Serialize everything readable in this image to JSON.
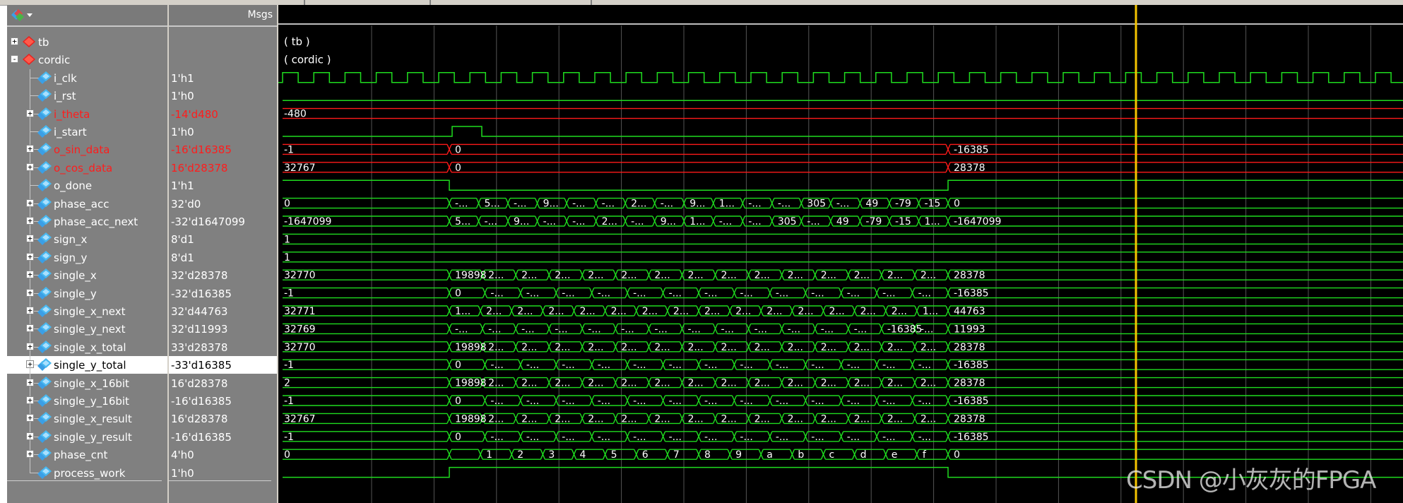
{
  "header": {
    "msgs_label": "Msgs"
  },
  "signals": [
    {
      "name": "tb",
      "value": "",
      "color": "white",
      "icon": "instance-icon",
      "expander": "+",
      "level": 0,
      "waveform": "label",
      "display": "( tb )"
    },
    {
      "name": "cordic",
      "value": "",
      "color": "white",
      "icon": "instance-icon",
      "expander": "-",
      "level": 0,
      "waveform": "label",
      "display": "( cordic )"
    },
    {
      "name": "i_clk",
      "value": "1'h1",
      "color": "white",
      "icon": "signal-icon",
      "expander": "",
      "level": 1,
      "waveform": "clock"
    },
    {
      "name": "i_rst",
      "value": "1'h0",
      "color": "white",
      "icon": "signal-icon",
      "expander": "",
      "level": 1,
      "waveform": "low"
    },
    {
      "name": "i_theta",
      "value": "-14'd480",
      "color": "red",
      "icon": "signal-icon",
      "expander": "+",
      "level": 1,
      "waveform": "bus",
      "wave_color": "red",
      "segments": [
        "-480"
      ]
    },
    {
      "name": "i_start",
      "value": "1'h0",
      "color": "white",
      "icon": "signal-icon",
      "expander": "",
      "level": 1,
      "waveform": "pulse"
    },
    {
      "name": "o_sin_data",
      "value": "-16'd16385",
      "color": "red",
      "icon": "signal-icon",
      "expander": "+",
      "level": 1,
      "waveform": "bus",
      "wave_color": "red",
      "segments": [
        "-1",
        "0",
        "-16385"
      ]
    },
    {
      "name": "o_cos_data",
      "value": "16'd28378",
      "color": "red",
      "icon": "signal-icon",
      "expander": "+",
      "level": 1,
      "waveform": "bus",
      "wave_color": "red",
      "segments": [
        "32767",
        "0",
        "28378"
      ]
    },
    {
      "name": "o_done",
      "value": "1'h1",
      "color": "white",
      "icon": "signal-icon",
      "expander": "",
      "level": 1,
      "waveform": "done"
    },
    {
      "name": "phase_acc",
      "value": "32'd0",
      "color": "white",
      "icon": "signal-icon",
      "expander": "+",
      "level": 1,
      "waveform": "bus",
      "wave_color": "green",
      "segments": [
        "0",
        "-...",
        "5...",
        "-...",
        "9...",
        "-...",
        "-...",
        "2...",
        "-...",
        "9...",
        "1...",
        "-...",
        "-...",
        "305",
        "-...",
        "49",
        "-79",
        "-15",
        "0"
      ]
    },
    {
      "name": "phase_acc_next",
      "value": "-32'd1647099",
      "color": "white",
      "icon": "signal-icon",
      "expander": "+",
      "level": 1,
      "waveform": "bus",
      "wave_color": "green",
      "segments": [
        "-1647099",
        "5...",
        "-...",
        "9...",
        "-...",
        "-...",
        "2...",
        "-...",
        "9...",
        "1...",
        "-...",
        "-...",
        "305",
        "-...",
        "49",
        "-79",
        "-15",
        "1...",
        "-1647099"
      ]
    },
    {
      "name": "sign_x",
      "value": "8'd1",
      "color": "white",
      "icon": "signal-icon",
      "expander": "+",
      "level": 1,
      "waveform": "bus",
      "wave_color": "green",
      "segments": [
        "1"
      ]
    },
    {
      "name": "sign_y",
      "value": "8'd1",
      "color": "white",
      "icon": "signal-icon",
      "expander": "+",
      "level": 1,
      "waveform": "bus",
      "wave_color": "green",
      "segments": [
        "1"
      ]
    },
    {
      "name": "single_x",
      "value": "32'd28378",
      "color": "white",
      "icon": "signal-icon",
      "expander": "+",
      "level": 1,
      "waveform": "bus",
      "wave_color": "green",
      "segments": [
        "32770",
        "19898",
        "2...",
        "2...",
        "2...",
        "2...",
        "2...",
        "2...",
        "2...",
        "2...",
        "2...",
        "2...",
        "2...",
        "2...",
        "2...",
        "2...",
        "28378"
      ]
    },
    {
      "name": "single_y",
      "value": "-32'd16385",
      "color": "white",
      "icon": "signal-icon",
      "expander": "+",
      "level": 1,
      "waveform": "bus",
      "wave_color": "green",
      "segments": [
        "-1",
        "0",
        "-...",
        "-...",
        "-...",
        "-...",
        "-...",
        "-...",
        "-...",
        "-...",
        "-...",
        "-...",
        "-...",
        "-...",
        "-...",
        "-16385"
      ]
    },
    {
      "name": "single_x_next",
      "value": "32'd44763",
      "color": "white",
      "icon": "signal-icon",
      "expander": "+",
      "level": 1,
      "waveform": "bus",
      "wave_color": "green",
      "segments": [
        "32771",
        "1...",
        "2...",
        "2...",
        "2...",
        "2...",
        "2...",
        "2...",
        "2...",
        "2...",
        "2...",
        "2...",
        "2...",
        "2...",
        "2...",
        "2...",
        "1...",
        "44763"
      ]
    },
    {
      "name": "single_y_next",
      "value": "32'd11993",
      "color": "white",
      "icon": "signal-icon",
      "expander": "+",
      "level": 1,
      "waveform": "bus",
      "wave_color": "green",
      "segments": [
        "32769",
        "-...",
        "-...",
        "-...",
        "-...",
        "-...",
        "-...",
        "-...",
        "-...",
        "-...",
        "-...",
        "-...",
        "-...",
        "-...",
        "-16385",
        "-...",
        "11993"
      ]
    },
    {
      "name": "single_x_total",
      "value": "33'd28378",
      "color": "white",
      "icon": "signal-icon",
      "expander": "+",
      "level": 1,
      "waveform": "bus",
      "wave_color": "green",
      "segments": [
        "32770",
        "19898",
        "2...",
        "2...",
        "2...",
        "2...",
        "2...",
        "2...",
        "2...",
        "2...",
        "2...",
        "2...",
        "2...",
        "2...",
        "2...",
        "2...",
        "28378"
      ]
    },
    {
      "name": "single_y_total",
      "value": "-33'd16385",
      "color": "white",
      "icon": "signal-icon",
      "expander": "+",
      "level": 1,
      "selected": true,
      "waveform": "bus",
      "wave_color": "green",
      "segments": [
        "-1",
        "0",
        "-...",
        "-...",
        "-...",
        "-...",
        "-...",
        "-...",
        "-...",
        "-...",
        "-...",
        "-...",
        "-...",
        "-...",
        "-...",
        "-16385"
      ]
    },
    {
      "name": "single_x_16bit",
      "value": "16'd28378",
      "color": "white",
      "icon": "signal-icon",
      "expander": "+",
      "level": 1,
      "waveform": "bus",
      "wave_color": "green",
      "segments": [
        "2",
        "19898",
        "2...",
        "2...",
        "2...",
        "2...",
        "2...",
        "2...",
        "2...",
        "2...",
        "2...",
        "2...",
        "2...",
        "2...",
        "2...",
        "2...",
        "28378"
      ]
    },
    {
      "name": "single_y_16bit",
      "value": "-16'd16385",
      "color": "white",
      "icon": "signal-icon",
      "expander": "+",
      "level": 1,
      "waveform": "bus",
      "wave_color": "green",
      "segments": [
        "-1",
        "0",
        "-...",
        "-...",
        "-...",
        "-...",
        "-...",
        "-...",
        "-...",
        "-...",
        "-...",
        "-...",
        "-...",
        "-...",
        "-...",
        "-16385"
      ]
    },
    {
      "name": "single_x_result",
      "value": "16'd28378",
      "color": "white",
      "icon": "signal-icon",
      "expander": "+",
      "level": 1,
      "waveform": "bus",
      "wave_color": "green",
      "segments": [
        "32767",
        "19898",
        "2...",
        "2...",
        "2...",
        "2...",
        "2...",
        "2...",
        "2...",
        "2...",
        "2...",
        "2...",
        "2...",
        "2...",
        "2...",
        "2...",
        "28378"
      ]
    },
    {
      "name": "single_y_result",
      "value": "-16'd16385",
      "color": "white",
      "icon": "signal-icon",
      "expander": "+",
      "level": 1,
      "waveform": "bus",
      "wave_color": "green",
      "segments": [
        "-1",
        "0",
        "-...",
        "-...",
        "-...",
        "-...",
        "-...",
        "-...",
        "-...",
        "-...",
        "-...",
        "-...",
        "-...",
        "-...",
        "-...",
        "-16385"
      ]
    },
    {
      "name": "phase_cnt",
      "value": "4'h0",
      "color": "white",
      "icon": "signal-icon",
      "expander": "+",
      "level": 1,
      "waveform": "bus",
      "wave_color": "green",
      "segments": [
        "0",
        "",
        "1",
        "2",
        "3",
        "4",
        "5",
        "6",
        "7",
        "8",
        "9",
        "a",
        "b",
        "c",
        "d",
        "e",
        "f",
        "0"
      ]
    },
    {
      "name": "process_work",
      "value": "1'h0",
      "color": "white",
      "icon": "signal-icon",
      "expander": "",
      "level": 1,
      "waveform": "work"
    }
  ],
  "colors": {
    "wave_green": "#1fdc1f",
    "wave_red": "#ff1a1a",
    "cursor": "#f5c400",
    "grid": "#555555"
  },
  "watermark": "CSDN @小灰灰的FPGA"
}
